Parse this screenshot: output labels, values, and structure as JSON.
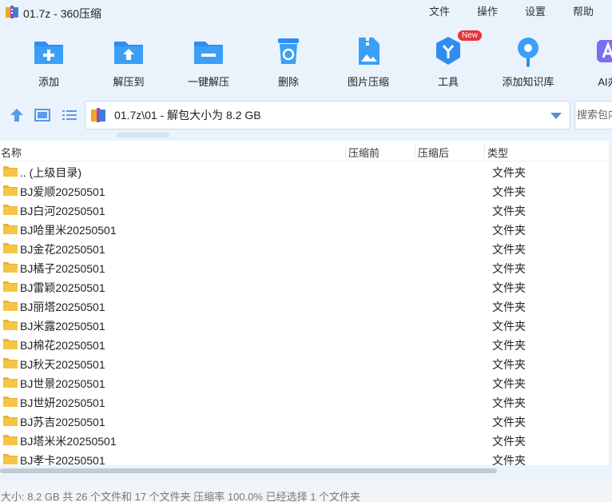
{
  "window": {
    "title": "01.7z - 360压缩",
    "menu": [
      "文件",
      "操作",
      "设置",
      "帮助"
    ]
  },
  "toolbar": {
    "items": [
      {
        "label": "添加",
        "icon": "add-folder-icon"
      },
      {
        "label": "解压到",
        "icon": "extract-to-icon"
      },
      {
        "label": "一键解压",
        "icon": "one-click-extract-icon"
      },
      {
        "label": "删除",
        "icon": "trash-icon"
      },
      {
        "label": "图片压缩",
        "icon": "image-compress-icon"
      },
      {
        "label": "工具",
        "icon": "tools-icon",
        "badge": "New"
      },
      {
        "label": "添加知识库",
        "icon": "knowledge-base-icon"
      },
      {
        "label": "AI办",
        "icon": "ai-icon"
      }
    ]
  },
  "address": {
    "path": "01.7z\\01 - 解包大小为 8.2 GB",
    "search_placeholder": "搜索包内"
  },
  "columns": [
    "名称",
    "压缩前",
    "压缩后",
    "类型"
  ],
  "rows": [
    {
      "name": ".. (上级目录)",
      "type": "文件夹"
    },
    {
      "name": "BJ爱顺20250501",
      "type": "文件夹"
    },
    {
      "name": "BJ白河20250501",
      "type": "文件夹"
    },
    {
      "name": "BJ哈里米20250501",
      "type": "文件夹"
    },
    {
      "name": "BJ金花20250501",
      "type": "文件夹"
    },
    {
      "name": "BJ橘子20250501",
      "type": "文件夹"
    },
    {
      "name": "BJ雷颖20250501",
      "type": "文件夹"
    },
    {
      "name": "BJ丽塔20250501",
      "type": "文件夹"
    },
    {
      "name": "BJ米露20250501",
      "type": "文件夹"
    },
    {
      "name": "BJ棉花20250501",
      "type": "文件夹"
    },
    {
      "name": "BJ秋天20250501",
      "type": "文件夹"
    },
    {
      "name": "BJ世景20250501",
      "type": "文件夹"
    },
    {
      "name": "BJ世妍20250501",
      "type": "文件夹"
    },
    {
      "name": "BJ苏吉20250501",
      "type": "文件夹"
    },
    {
      "name": "BJ塔米米20250501",
      "type": "文件夹"
    },
    {
      "name": "BJ孝卡20250501",
      "type": "文件夹"
    }
  ],
  "status": "大小: 8.2 GB 共 26 个文件和 17 个文件夹 压缩率 100.0% 已经选择 1 个文件夹",
  "colors": {
    "accent": "#2e8ef0",
    "folder": "#f7c544",
    "badge": "#e8343a"
  }
}
